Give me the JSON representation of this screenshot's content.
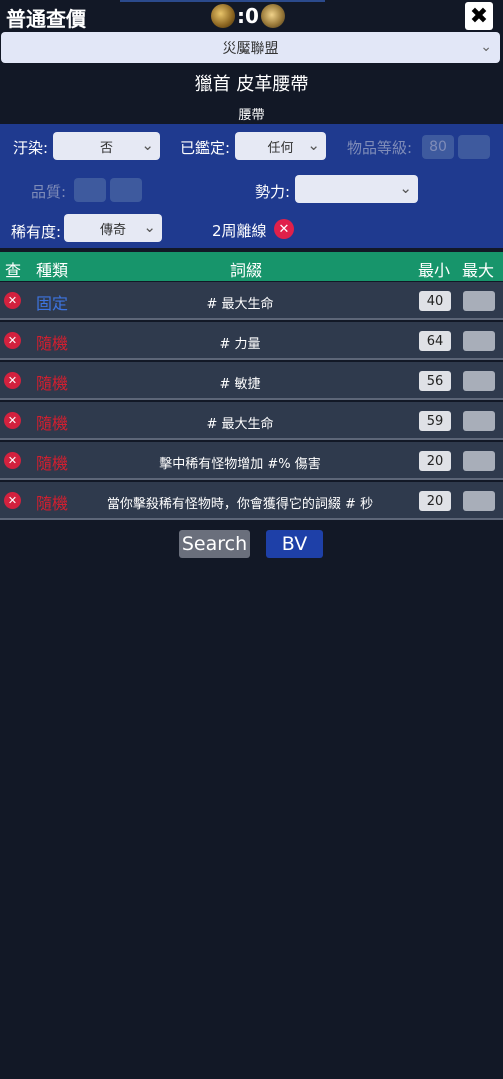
{
  "app": {
    "title": "普通查價",
    "close_icon": "✖"
  },
  "currency": {
    "count_label": ":0",
    "left_icon": "chaos-orb-icon",
    "right_icon": "divine-orb-icon"
  },
  "league": {
    "selected": "災魘聯盟"
  },
  "item": {
    "name": "獵首  皮革腰帶",
    "class": "腰帶"
  },
  "filters": {
    "corrupted_label": "汙染:",
    "corrupted_value": "否",
    "identified_label": "已鑑定:",
    "identified_value": "任何",
    "ilvl_label": "物品等級:",
    "ilvl_min": "80",
    "ilvl_max": "",
    "quality_label": "品質:",
    "quality_min": "",
    "quality_max": "",
    "influence_label": "勢力:",
    "influence_value": "",
    "rarity_label": "稀有度:",
    "rarity_value": "傳奇",
    "offline_label": "2周離線"
  },
  "table": {
    "headers": {
      "check": "查",
      "kind": "種類",
      "mod": "詞綴",
      "min": "最小",
      "max": "最大"
    },
    "rows": [
      {
        "kind": "固定",
        "mod": "# 最大生命",
        "min": "40",
        "max": ""
      },
      {
        "kind": "隨機",
        "mod": "# 力量",
        "min": "64",
        "max": ""
      },
      {
        "kind": "隨機",
        "mod": "# 敏捷",
        "min": "56",
        "max": ""
      },
      {
        "kind": "隨機",
        "mod": "# 最大生命",
        "min": "59",
        "max": ""
      },
      {
        "kind": "隨機",
        "mod": "擊中稀有怪物增加 #% 傷害",
        "min": "20",
        "max": ""
      },
      {
        "kind": "隨機",
        "mod": "當你擊殺稀有怪物時，你會獲得它的詞綴 # 秒",
        "min": "20",
        "max": ""
      }
    ]
  },
  "actions": {
    "search_label": "Search",
    "bv_label": "BV"
  },
  "colors": {
    "filter_panel": "#1f3a8f",
    "table_header": "#17956b",
    "fixed": "#3d74e0",
    "random": "#d31f2f"
  }
}
